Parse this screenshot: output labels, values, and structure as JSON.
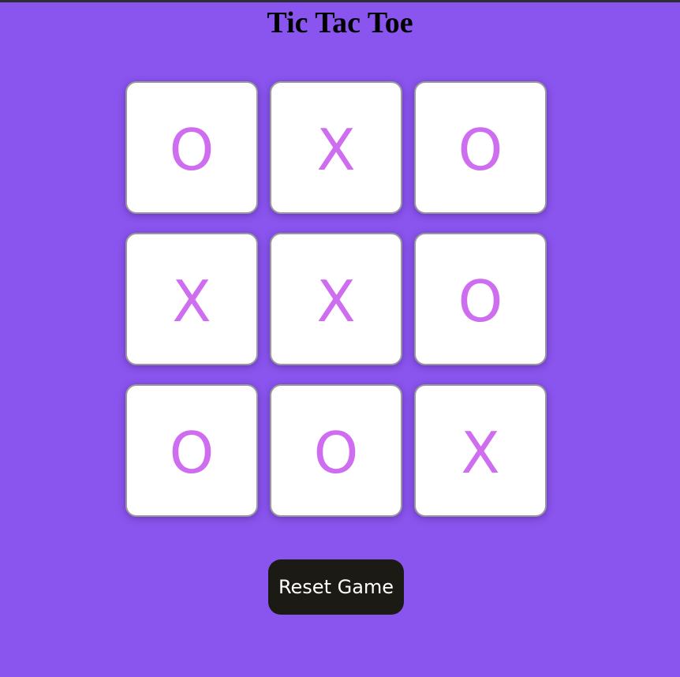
{
  "title": "Tic Tac Toe",
  "board": {
    "cells": [
      "O",
      "X",
      "O",
      "X",
      "X",
      "O",
      "O",
      "O",
      "X"
    ]
  },
  "reset_label": "Reset Game",
  "colors": {
    "background": "#8a55ee",
    "mark": "#cf6df0",
    "cell": "#ffffff",
    "button": "#1b1a14"
  }
}
